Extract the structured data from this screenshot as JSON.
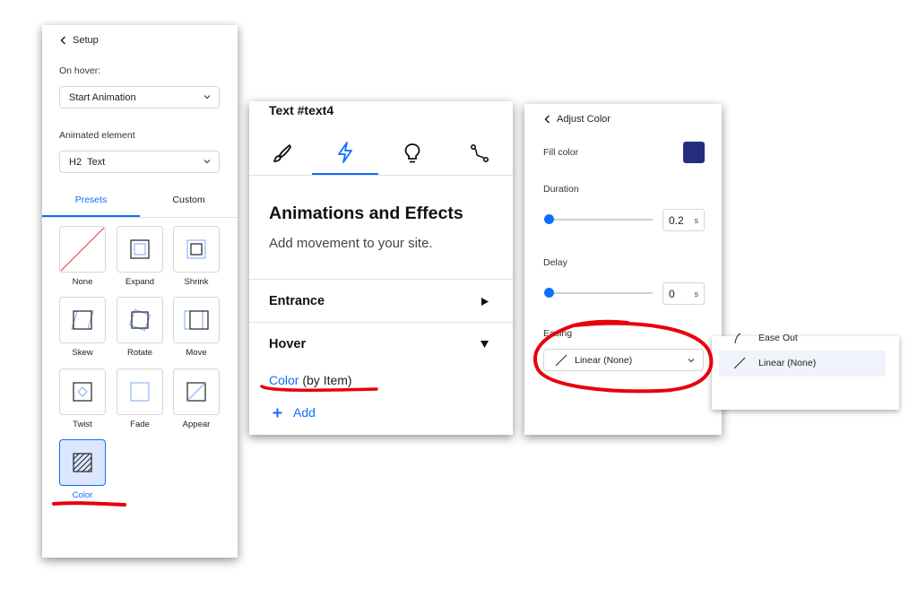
{
  "setup_panel": {
    "back_label": "Setup",
    "on_hover_label": "On hover:",
    "on_hover_value": "Start Animation",
    "animated_element_label": "Animated element",
    "animated_element_tag": "H2",
    "animated_element_value": "Text",
    "tabs": [
      "Presets",
      "Custom"
    ],
    "presets": [
      "None",
      "Expand",
      "Shrink",
      "Skew",
      "Rotate",
      "Move",
      "Twist",
      "Fade",
      "Appear",
      "Color"
    ],
    "selected_preset": "Color"
  },
  "effects_panel": {
    "element_title": "Text #text4",
    "heading": "Animations and Effects",
    "subheading": "Add movement to your site.",
    "entrance_label": "Entrance",
    "hover_label": "Hover",
    "hover_item_link": "Color",
    "hover_item_suffix": "(by Item)",
    "add_label": "Add",
    "icon_tabs": [
      "brush-icon",
      "lightning-icon",
      "lightbulb-icon",
      "path-icon"
    ]
  },
  "adjust_panel": {
    "back_label": "Adjust Color",
    "fill_color_label": "Fill color",
    "fill_color": "#242d80",
    "duration_label": "Duration",
    "duration_value": "0.2",
    "duration_unit": "s",
    "delay_label": "Delay",
    "delay_value": "0",
    "delay_unit": "s",
    "easing_label": "Easing",
    "easing_value": "Linear (None)"
  },
  "easing_popup": {
    "items": [
      "Ease Out",
      "Linear (None)"
    ],
    "highlighted": "Linear (None)"
  },
  "colors": {
    "accent": "#116dff",
    "annotation": "#e8000b"
  }
}
